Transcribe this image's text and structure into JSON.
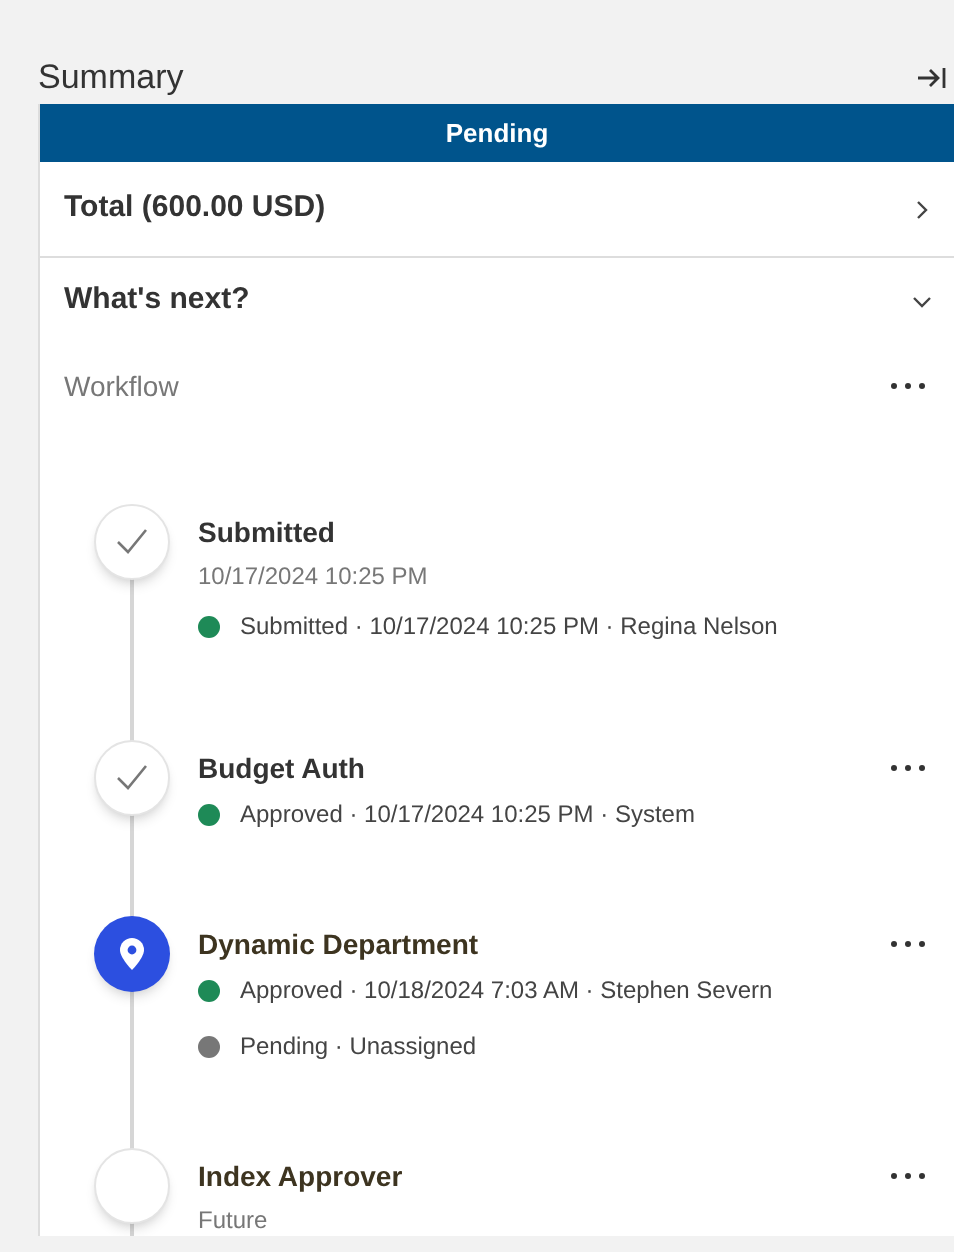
{
  "header": {
    "title": "Summary"
  },
  "status_banner": {
    "label": "Pending"
  },
  "sections": [
    {
      "label": "Total (600.00 USD)",
      "expanded": false
    },
    {
      "label": "What's next?",
      "expanded": true
    }
  ],
  "workflow": {
    "label": "Workflow",
    "steps": [
      {
        "kind": "done",
        "title": "Submitted",
        "subtitle": "10/17/2024 10:25 PM",
        "menu": false,
        "events": [
          {
            "text": "Submitted · 10/17/2024 10:25 PM · Regina Nelson",
            "color": "#1e8a57"
          }
        ]
      },
      {
        "kind": "done",
        "title": "Budget Auth",
        "menu": true,
        "events": [
          {
            "text": "Approved · 10/17/2024 10:25 PM · System",
            "color": "#1e8a57"
          }
        ]
      },
      {
        "kind": "current",
        "title": "Dynamic Department",
        "menu": true,
        "events": [
          {
            "text": "Approved · 10/18/2024 7:03 AM · Stephen Severn",
            "color": "#1e8a57"
          },
          {
            "text": "Pending · Unassigned",
            "color": "#777777"
          }
        ]
      },
      {
        "kind": "future",
        "title": "Index Approver",
        "subtitle": "Future",
        "menu": true
      }
    ]
  }
}
